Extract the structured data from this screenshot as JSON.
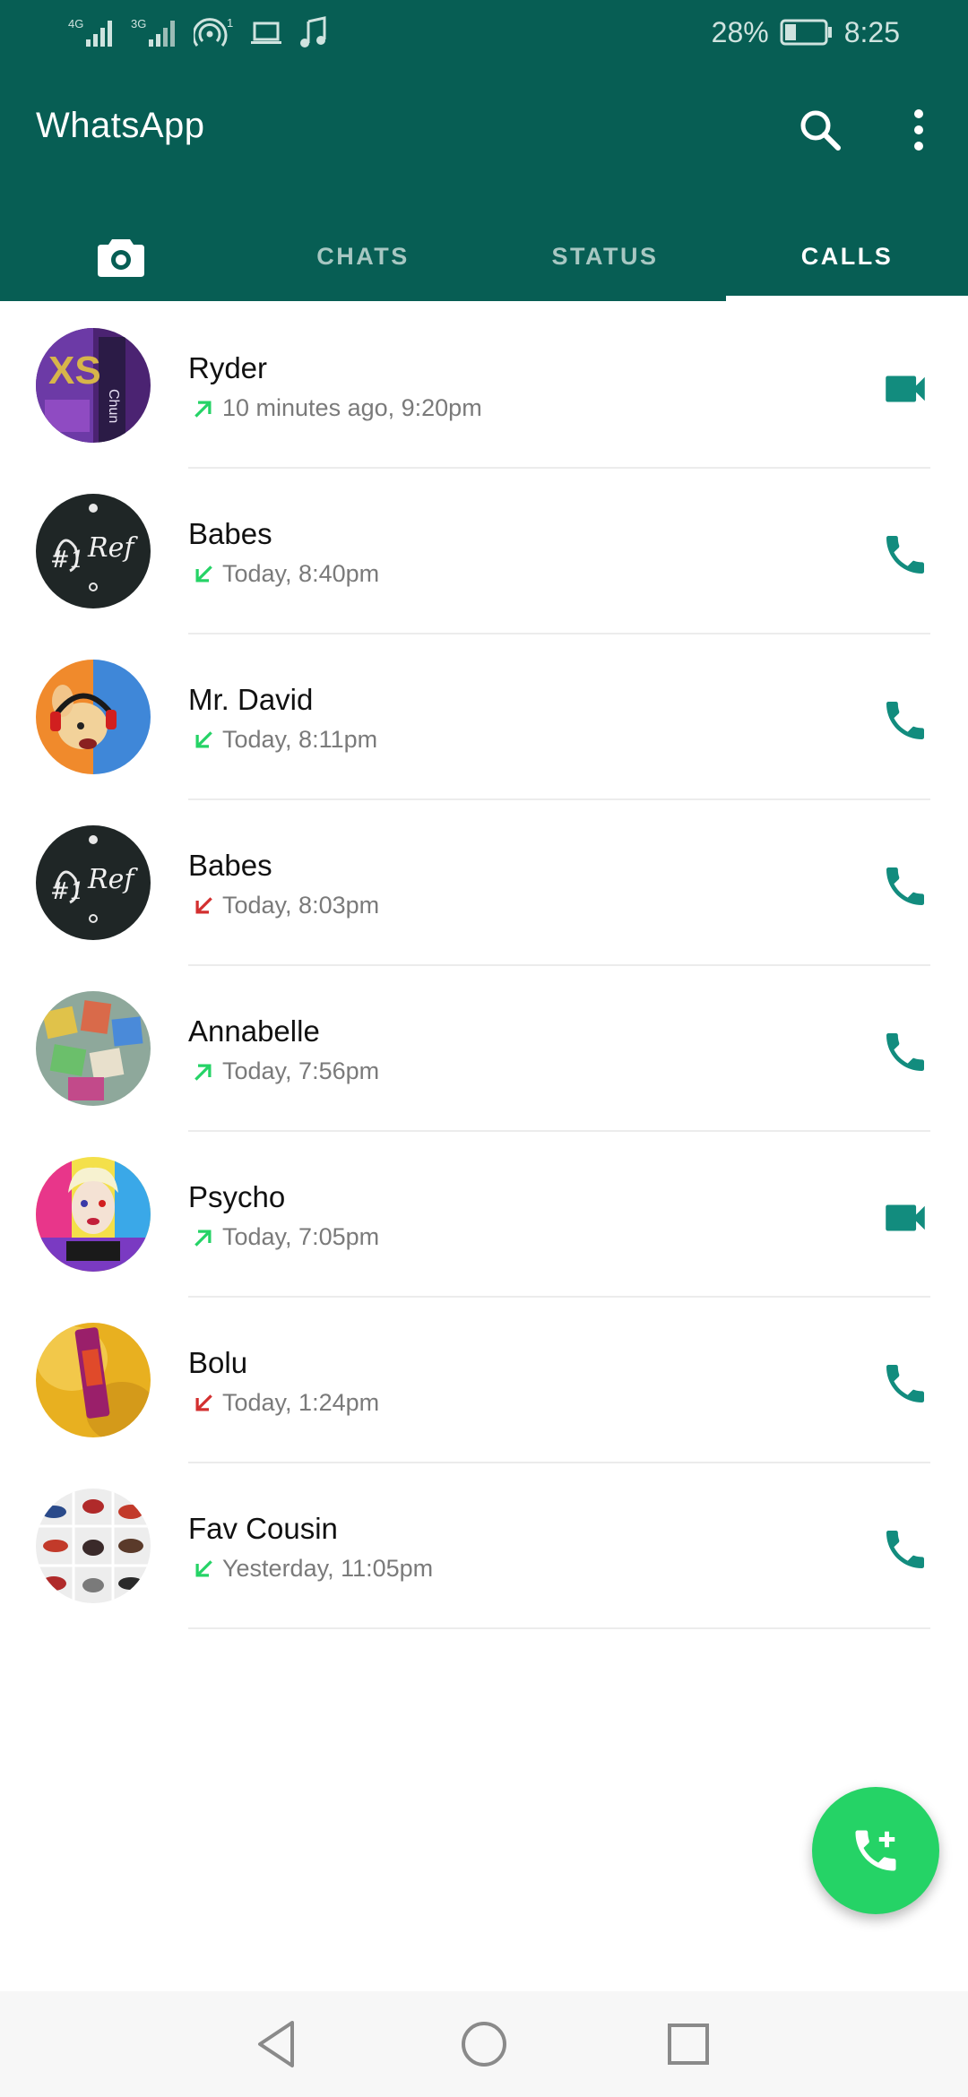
{
  "status_bar": {
    "network_1": "4G",
    "network_2": "3G",
    "hotspot_count": "1",
    "battery_percent": "28%",
    "battery_level": 0.28,
    "time": "8:25"
  },
  "app_bar": {
    "title": "WhatsApp",
    "icons": [
      "search-icon",
      "more-vert-icon"
    ]
  },
  "tabs": [
    {
      "label": "",
      "icon": "camera-icon",
      "active": false
    },
    {
      "label": "CHATS",
      "active": false
    },
    {
      "label": "STATUS",
      "active": false
    },
    {
      "label": "CALLS",
      "active": true
    }
  ],
  "calls": [
    {
      "name": "Ryder",
      "direction": "outgoing",
      "time": "10 minutes ago, 9:20pm",
      "type": "video"
    },
    {
      "name": "Babes",
      "direction": "incoming",
      "time": "Today, 8:40pm",
      "type": "voice"
    },
    {
      "name": "Mr. David",
      "direction": "incoming",
      "time": "Today, 8:11pm",
      "type": "voice"
    },
    {
      "name": "Babes",
      "direction": "missed",
      "time": "Today, 8:03pm",
      "type": "voice"
    },
    {
      "name": "Annabelle",
      "direction": "outgoing",
      "time": "Today, 7:56pm",
      "type": "voice"
    },
    {
      "name": "Psycho",
      "direction": "outgoing",
      "time": "Today, 7:05pm",
      "type": "video"
    },
    {
      "name": "Bolu",
      "direction": "missed",
      "time": "Today, 1:24pm",
      "type": "voice"
    },
    {
      "name": "Fav Cousin",
      "direction": "incoming",
      "time": "Yesterday, 11:05pm",
      "type": "voice"
    }
  ],
  "fab": {
    "icon": "add-call-icon"
  },
  "nav_bar": {
    "icons": [
      "back-icon",
      "home-icon",
      "recents-icon"
    ]
  },
  "colors": {
    "header": "#075e54",
    "accent": "#128c7e",
    "fab": "#25d366",
    "outgoing_arrow": "#25d366",
    "incoming_arrow": "#25d366",
    "missed_arrow": "#d32f2f"
  }
}
